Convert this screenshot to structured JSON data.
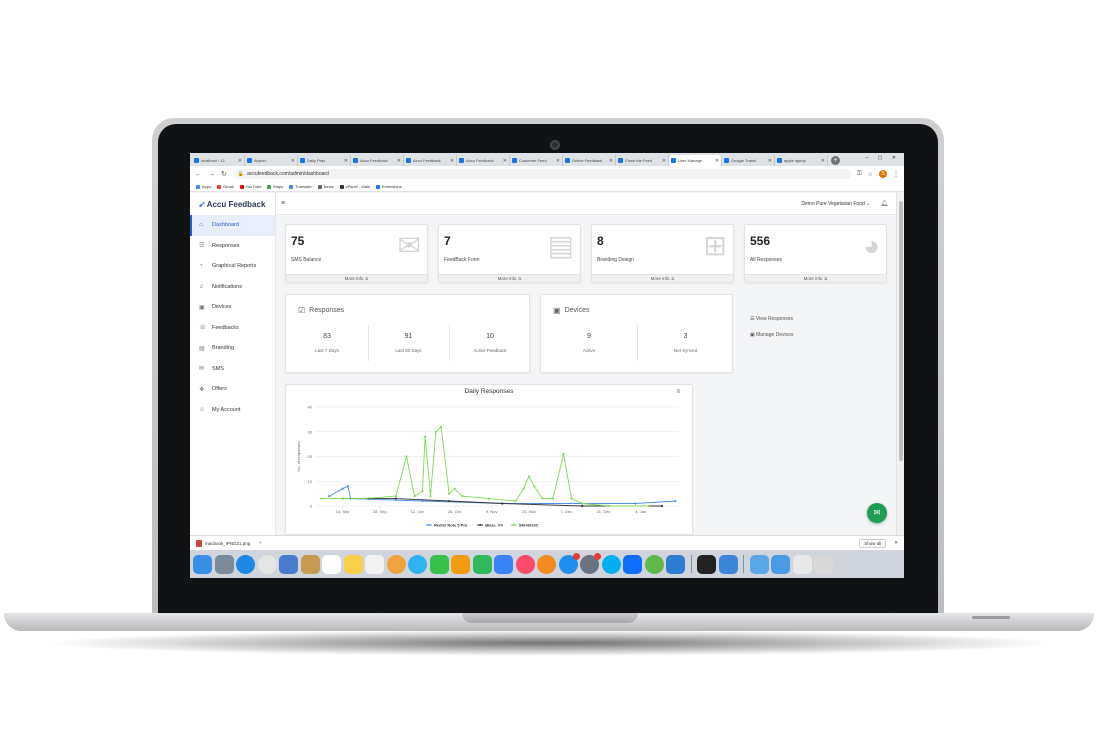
{
  "browser": {
    "tabs": [
      {
        "label": "localhost / 12"
      },
      {
        "label": "Airport"
      },
      {
        "label": "Daily Prax"
      },
      {
        "label": "Accu Feedback"
      },
      {
        "label": "Accu Feedback"
      },
      {
        "label": "Accu Feedback"
      },
      {
        "label": "Customer Feed"
      },
      {
        "label": "Online Feedback"
      },
      {
        "label": "Close the Feed"
      },
      {
        "label": "User Manage"
      },
      {
        "label": "Google Transl"
      },
      {
        "label": "apple laptop"
      }
    ],
    "url": "accufeedback.com/admin/dashboard",
    "bookmarks": [
      "Apps",
      "Gmail",
      "YouTube",
      "Maps",
      "Translate",
      "News",
      "cPanel - Main",
      "Extensions"
    ]
  },
  "app": {
    "brand": "Accu Feedback",
    "org_selector": "Demo Pure Vegetarian Food",
    "sidebar": [
      {
        "label": "Dashboard",
        "icon": "home-icon"
      },
      {
        "label": "Responses",
        "icon": "list-icon"
      },
      {
        "label": "Graphical Reports",
        "icon": "chart-icon"
      },
      {
        "label": "Notifications",
        "icon": "bell-icon"
      },
      {
        "label": "Devices",
        "icon": "device-icon"
      },
      {
        "label": "Feedbacks",
        "icon": "feedback-icon"
      },
      {
        "label": "Branding",
        "icon": "branding-icon"
      },
      {
        "label": "SMS",
        "icon": "sms-icon"
      },
      {
        "label": "Offers",
        "icon": "gift-icon"
      },
      {
        "label": "My Account",
        "icon": "user-icon"
      }
    ],
    "stats": [
      {
        "value": "75",
        "label": "SMS Balance",
        "icon": "envelope-icon",
        "more": "More info"
      },
      {
        "value": "7",
        "label": "FeedBack Form",
        "icon": "document-icon",
        "more": "More info"
      },
      {
        "value": "8",
        "label": "Branding Design",
        "icon": "windows-icon",
        "more": "More info"
      },
      {
        "value": "556",
        "label": "All Responses",
        "icon": "pie-icon",
        "more": "More info"
      }
    ],
    "responses_panel": {
      "title": "Responses",
      "metrics": [
        {
          "value": "83",
          "label": "Last 7 Days"
        },
        {
          "value": "91",
          "label": "Last 30 Days"
        },
        {
          "value": "10",
          "label": "Active Feedback"
        }
      ]
    },
    "devices_panel": {
      "title": "Devices",
      "metrics": [
        {
          "value": "9",
          "label": "Active"
        },
        {
          "value": "3",
          "label": "Not Synced"
        }
      ]
    },
    "quick_links": [
      "View Responses",
      "Manage Devices"
    ]
  },
  "chart_data": {
    "type": "line",
    "title": "Daily Responses",
    "ylabel": "No. of responses",
    "xlabel": "",
    "ylim": [
      0,
      40
    ],
    "yticks": [
      0,
      10,
      20,
      30,
      40
    ],
    "xticks": [
      "14. Sep",
      "28. Sep",
      "12. Oct",
      "26. Oct",
      "9. Nov",
      "23. Nov",
      "7. Dec",
      "21. Dec",
      "4. Jan"
    ],
    "x_day_offsets": [
      0,
      14,
      28,
      42,
      56,
      70,
      84,
      98,
      112
    ],
    "grid": true,
    "legend": "bottom",
    "series": [
      {
        "name": "Redmi Note 5 Pro",
        "color": "#4a90e2",
        "points": [
          [
            -5,
            4
          ],
          [
            0,
            7
          ],
          [
            2,
            8
          ],
          [
            3,
            3
          ],
          [
            30,
            2
          ],
          [
            60,
            1
          ],
          [
            90,
            1
          ],
          [
            110,
            1
          ],
          [
            125,
            2
          ]
        ]
      },
      {
        "name": "Blaze_V4",
        "color": "#333333",
        "points": [
          [
            0,
            3
          ],
          [
            10,
            3
          ],
          [
            20,
            3
          ],
          [
            40,
            2
          ],
          [
            60,
            1
          ],
          [
            90,
            0
          ],
          [
            120,
            0
          ]
        ]
      },
      {
        "name": "SM-N910C",
        "color": "#7ed957",
        "points": [
          [
            -8,
            3
          ],
          [
            0,
            3
          ],
          [
            8,
            3
          ],
          [
            20,
            4
          ],
          [
            24,
            20
          ],
          [
            27,
            4
          ],
          [
            30,
            6
          ],
          [
            31,
            28
          ],
          [
            33,
            4
          ],
          [
            35,
            30
          ],
          [
            37,
            32
          ],
          [
            40,
            5
          ],
          [
            42,
            7
          ],
          [
            45,
            4
          ],
          [
            55,
            3
          ],
          [
            65,
            2
          ],
          [
            68,
            7
          ],
          [
            70,
            12
          ],
          [
            72,
            8
          ],
          [
            75,
            3
          ],
          [
            79,
            3
          ],
          [
            83,
            21
          ],
          [
            86,
            3
          ],
          [
            90,
            1
          ],
          [
            100,
            0
          ],
          [
            115,
            0
          ]
        ]
      }
    ]
  },
  "downloads": {
    "file": "macbook_iPNG21.png",
    "show_all": "Show all"
  },
  "dock": {
    "icons": [
      "finder-icon",
      "launchpad-icon",
      "safari-icon",
      "chrome-icon",
      "preview-icon",
      "notes-app-icon",
      "calendar-icon",
      "stickies-icon",
      "reminders-icon",
      "photos-icon",
      "messages-icon",
      "facetime-icon",
      "pages-icon",
      "numbers-icon",
      "keynote-icon",
      "music-icon",
      "books-icon",
      "appstore-icon",
      "settings-icon",
      "skype-icon",
      "teamviewer-icon",
      "camo-icon",
      "vscode-icon",
      "terminal-icon",
      "mail-app-icon",
      "folder-icon",
      "downloads-folder-icon",
      "screen-icon",
      "trash-icon"
    ]
  }
}
